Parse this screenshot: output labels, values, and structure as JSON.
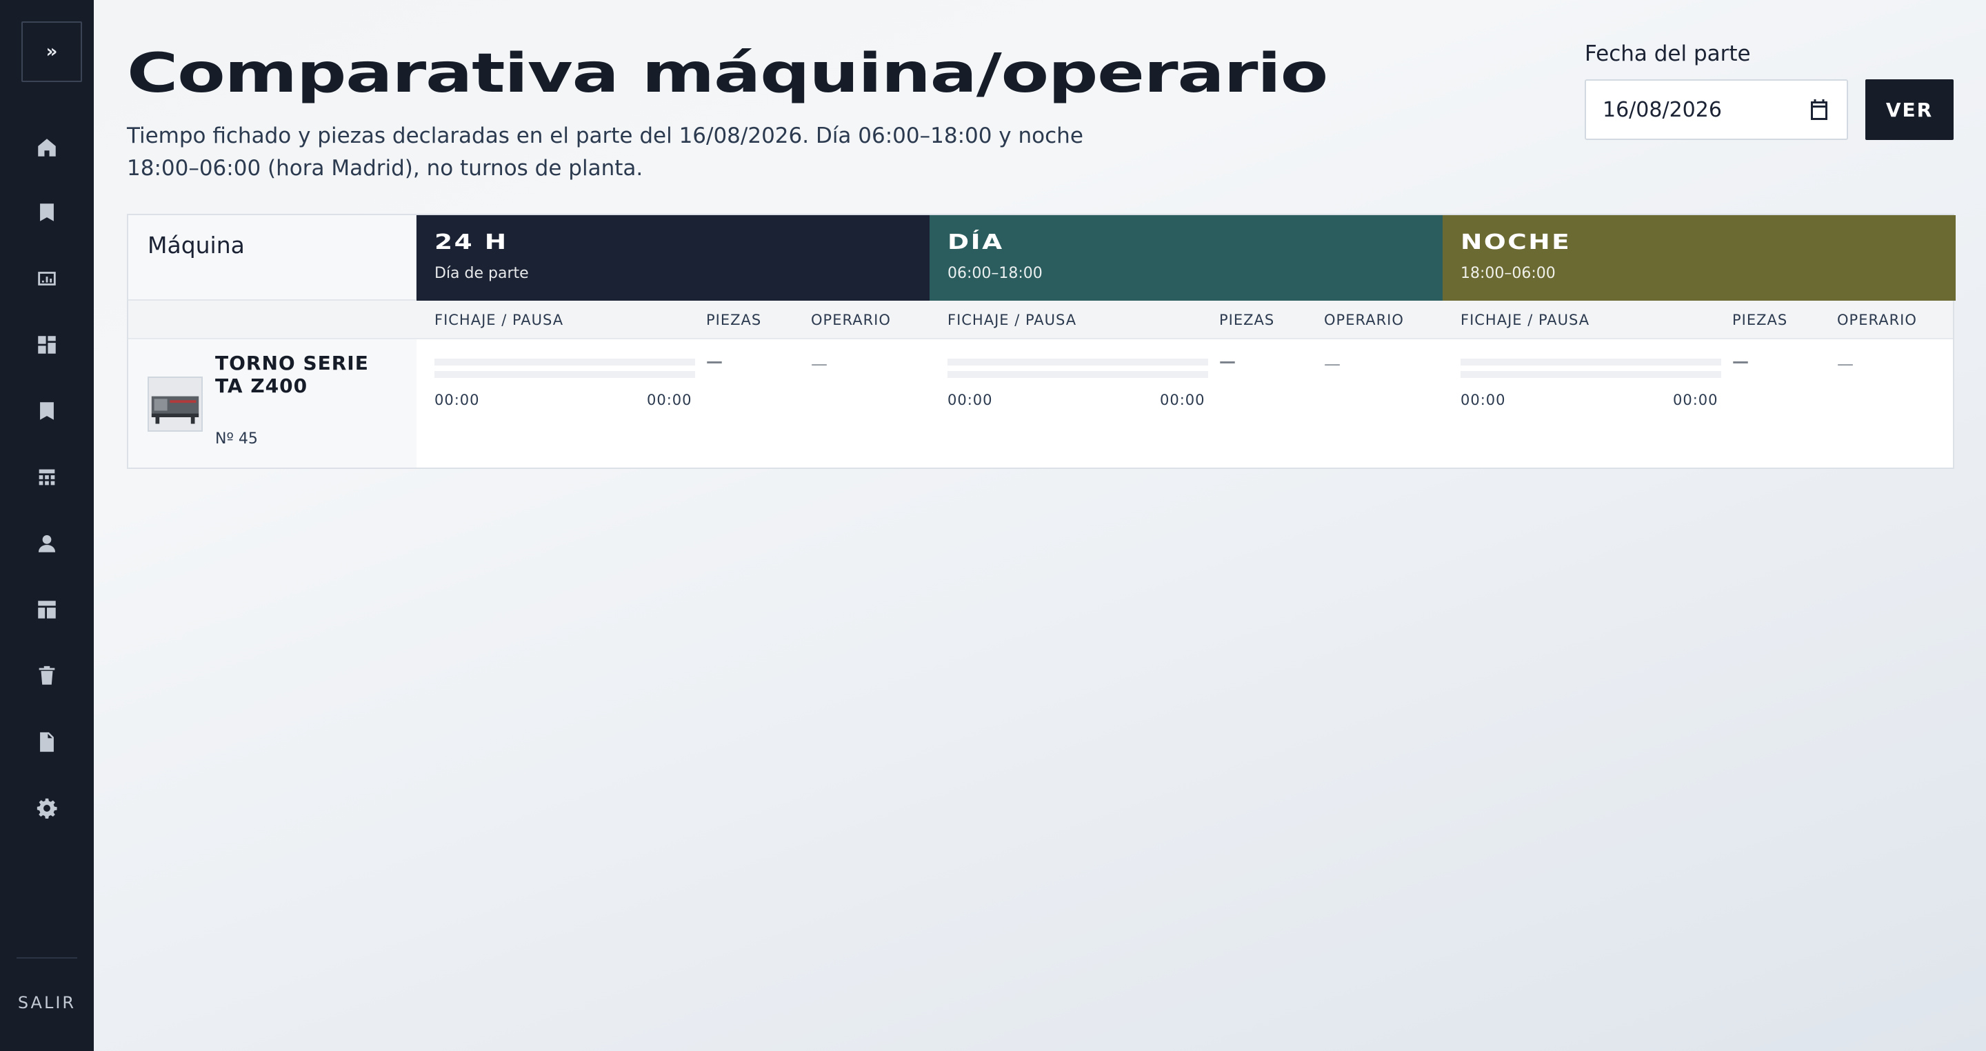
{
  "sidebar": {
    "toggle": "»",
    "icons": [
      "home-icon",
      "bookmark-icon",
      "chart-icon",
      "dashboard-icon",
      "bookmark-alt-icon",
      "grid-icon",
      "user-icon",
      "layout-icon",
      "trash-icon",
      "document-icon",
      "gear-icon"
    ],
    "logout": "SALIR"
  },
  "header": {
    "title": "Comparativa máquina/operario",
    "subtitle": "Tiempo fichado y piezas declaradas en el parte del 16/08/2026. Día 06:00–18:00 y noche 18:00–06:00 (hora Madrid), no turnos de planta."
  },
  "filter": {
    "date_label": "Fecha del parte",
    "date_value": "16/08/2026",
    "submit_label": "VER"
  },
  "table": {
    "machine_header": "Máquina",
    "shifts": [
      {
        "name": "24 H",
        "range": "Día de parte",
        "color": "#1a2233"
      },
      {
        "name": "DÍA",
        "range": "06:00–18:00",
        "color": "#2b5c5e"
      },
      {
        "name": "NOCHE",
        "range": "18:00–06:00",
        "color": "#6b6a32"
      }
    ],
    "columns": [
      "FICHAJE / PAUSA",
      "PIEZAS",
      "OPERARIO"
    ],
    "rows": [
      {
        "machine_name": "TORNO SERIE TA Z400",
        "machine_number": "Nº 45",
        "cells": [
          {
            "start": "00:00",
            "end": "00:00",
            "pieces": "—",
            "operator": "—"
          },
          {
            "start": "00:00",
            "end": "00:00",
            "pieces": "—",
            "operator": "—"
          },
          {
            "start": "00:00",
            "end": "00:00",
            "pieces": "—",
            "operator": "—"
          }
        ]
      }
    ]
  }
}
